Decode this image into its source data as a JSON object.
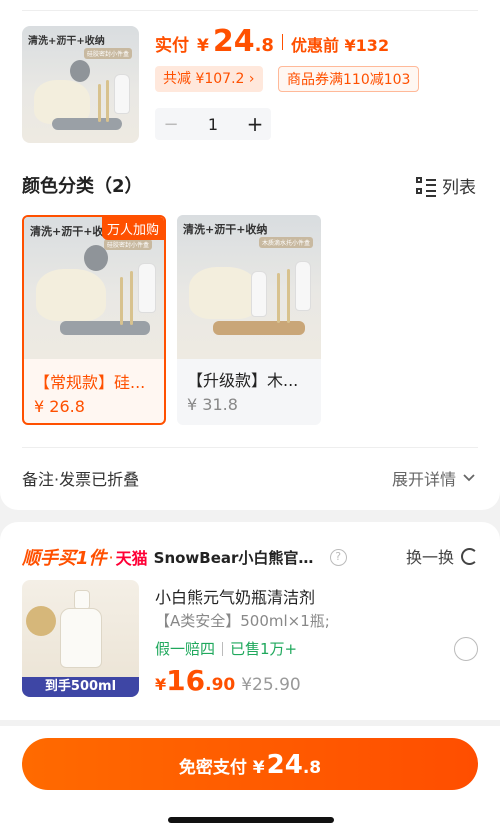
{
  "product": {
    "thumb_banner": "清洗+沥干+收纳",
    "thumb_pill": "硅胶密封小件盒",
    "paid_label": "实付",
    "paid_yen": "¥",
    "paid_int": "24",
    "paid_dec": ".8",
    "before_label": "优惠前 ¥132",
    "discount_tag": "共减 ¥107.2 ›",
    "coupon_tag": "商品券满110减103",
    "quantity": "1",
    "minus": "−",
    "plus": "+"
  },
  "variants": {
    "title": "颜色分类（2）",
    "list_label": "列表",
    "items": [
      {
        "name": "【常规款】硅胶密封小件盒",
        "price": "¥ 26.8",
        "badge": "万人加购",
        "banner": "清洗+沥干+收纳",
        "pill": "硅胶密封小件盒"
      },
      {
        "name": "【升级款】木质滴水托",
        "price": "¥ 31.8",
        "badge": "",
        "banner": "清洗+沥干+收纳",
        "pill": "木质滴水托小件盒"
      }
    ]
  },
  "note": {
    "label": "备注·发票已折叠",
    "expand": "展开详情"
  },
  "bundle": {
    "title": "顺手买1件",
    "dot": "·",
    "tmall": "天猫",
    "store": "SnowBear小白熊官方旗舰店",
    "swap": "换一换",
    "item_title": "小白熊元气奶瓶清洁剂",
    "spec": "【A类安全】500ml×1瓶;",
    "guarantee": "假一赔四",
    "sold": "已售1万+",
    "price_yen": "¥",
    "price_int": "16",
    "price_dec": ".90",
    "orig_price": "¥25.90",
    "thumb_strip": "到手500ml"
  },
  "pay": {
    "label": "免密支付 ¥",
    "int": "24",
    "dec": ".8"
  },
  "colors": {
    "accent": "#ff5000",
    "green": "#1fa85c",
    "tmall_red": "#ff0036"
  }
}
